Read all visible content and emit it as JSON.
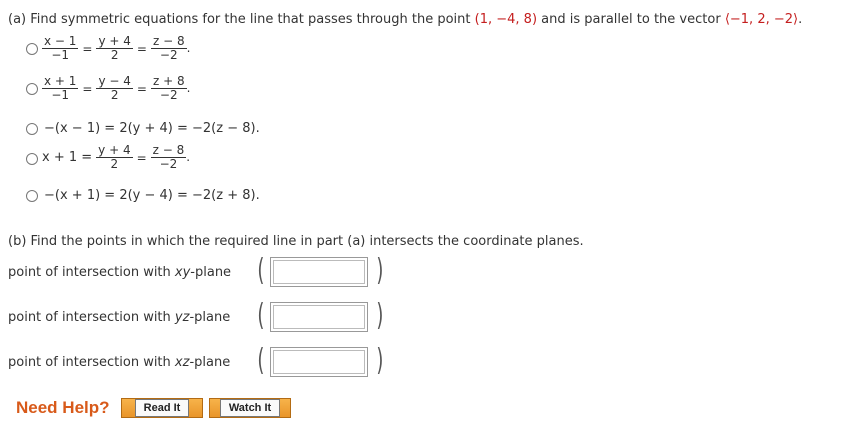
{
  "part_a": {
    "prompt": "(a) Find symmetric equations for the line that passes through the point",
    "point": "(1, −4, 8)",
    "middle": "and is parallel to the vector",
    "vector": "⟨−1, 2, −2⟩",
    "end": ".",
    "choices": [
      {
        "f1_num": "x − 1",
        "f1_den": "−1",
        "f2_num": "y + 4",
        "f2_den": "2",
        "f3_num": "z − 8",
        "f3_den": "−2"
      },
      {
        "f1_num": "x + 1",
        "f1_den": "−1",
        "f2_num": "y − 4",
        "f2_den": "2",
        "f3_num": "z + 8",
        "f3_den": "−2"
      },
      {
        "text": "−(x − 1) = 2(y + 4) = −2(z − 8)."
      },
      {
        "prefix": "x + 1 =",
        "f2_num": "y + 4",
        "f2_den": "2",
        "f3_num": "z − 8",
        "f3_den": "−2"
      },
      {
        "text": "−(x + 1) = 2(y − 4) = −2(z + 8)."
      }
    ]
  },
  "part_b": {
    "prompt": "(b) Find the points in which the required line in part (a) intersects the coordinate planes.",
    "rows": [
      {
        "label_pre": "point of intersection with ",
        "plane": "xy",
        "label_post": "-plane",
        "value": ""
      },
      {
        "label_pre": "point of intersection with ",
        "plane": "yz",
        "label_post": "-plane",
        "value": ""
      },
      {
        "label_pre": "point of intersection with ",
        "plane": "xz",
        "label_post": "-plane",
        "value": ""
      }
    ]
  },
  "help": {
    "label": "Need Help?",
    "read_label": "Read It",
    "watch_label": "Watch It"
  }
}
